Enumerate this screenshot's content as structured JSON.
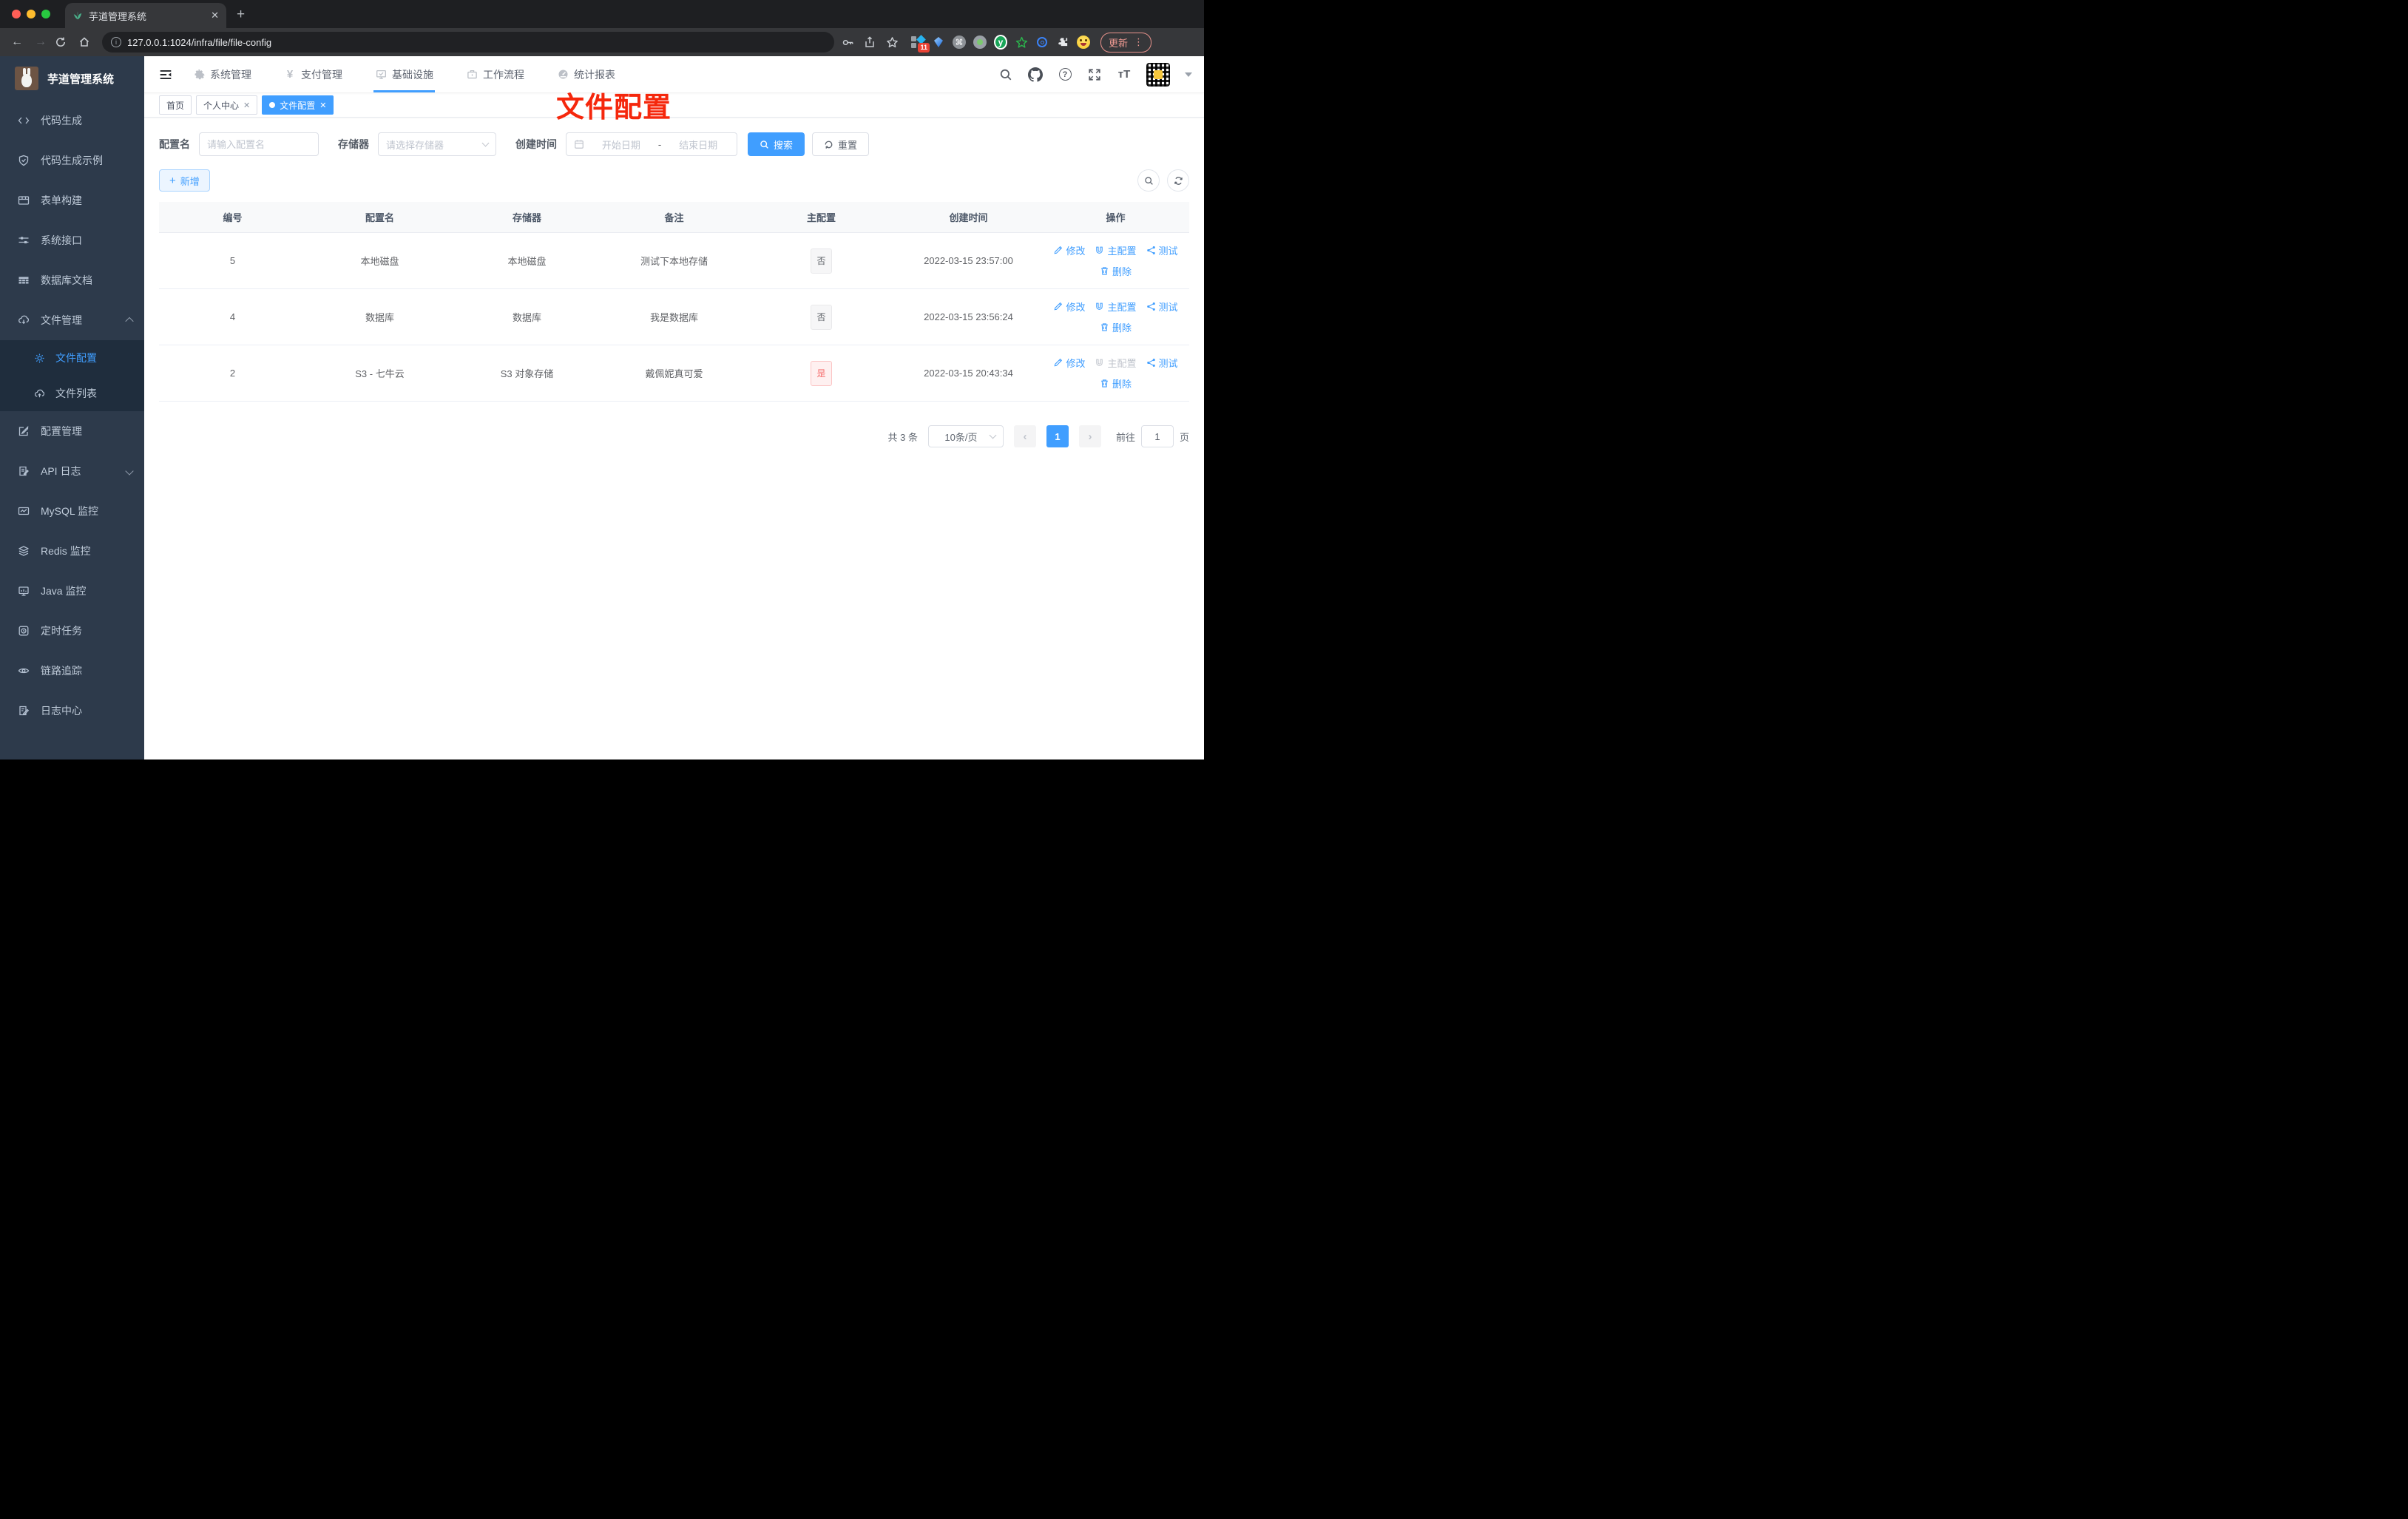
{
  "browser": {
    "tab_title": "芋道管理系统",
    "url": "127.0.0.1:1024/infra/file/file-config",
    "update_label": "更新",
    "extension_badge": "11"
  },
  "annotation_text": "文件配置",
  "sidebar": {
    "title": "芋道管理系统",
    "items": [
      {
        "label": "代码生成"
      },
      {
        "label": "代码生成示例"
      },
      {
        "label": "表单构建"
      },
      {
        "label": "系统接口"
      },
      {
        "label": "数据库文档"
      },
      {
        "label": "文件管理",
        "expanded": true,
        "children": [
          {
            "label": "文件配置",
            "active": true
          },
          {
            "label": "文件列表"
          }
        ]
      },
      {
        "label": "配置管理"
      },
      {
        "label": "API 日志"
      },
      {
        "label": "MySQL 监控"
      },
      {
        "label": "Redis 监控"
      },
      {
        "label": "Java 监控"
      },
      {
        "label": "定时任务"
      },
      {
        "label": "链路追踪"
      },
      {
        "label": "日志中心"
      }
    ]
  },
  "header": {
    "nav": [
      {
        "label": "系统管理"
      },
      {
        "label": "支付管理"
      },
      {
        "label": "基础设施",
        "active": true
      },
      {
        "label": "工作流程"
      },
      {
        "label": "统计报表"
      }
    ],
    "pay_symbol": "¥",
    "font_size_icon": "тT"
  },
  "tags": [
    {
      "label": "首页"
    },
    {
      "label": "个人中心",
      "closable": true
    },
    {
      "label": "文件配置",
      "closable": true,
      "active": true
    }
  ],
  "filters": {
    "name_label": "配置名",
    "name_placeholder": "请输入配置名",
    "storage_label": "存储器",
    "storage_placeholder": "请选择存储器",
    "time_label": "创建时间",
    "start_placeholder": "开始日期",
    "range_separator": "-",
    "end_placeholder": "结束日期",
    "search_label": "搜索",
    "reset_label": "重置"
  },
  "toolbar": {
    "add_label": "新增"
  },
  "table": {
    "headers": [
      "编号",
      "配置名",
      "存储器",
      "备注",
      "主配置",
      "创建时间",
      "操作"
    ],
    "actions": {
      "edit": "修改",
      "master": "主配置",
      "test": "测试",
      "delete": "删除"
    },
    "rows": [
      {
        "id": "5",
        "name": "本地磁盘",
        "storage": "本地磁盘",
        "remark": "测试下本地存储",
        "master": "否",
        "time": "2022-03-15 23:57:00"
      },
      {
        "id": "4",
        "name": "数据库",
        "storage": "数据库",
        "remark": "我是数据库",
        "master": "否",
        "time": "2022-03-15 23:56:24"
      },
      {
        "id": "2",
        "name": "S3 - 七牛云",
        "storage": "S3 对象存储",
        "remark": "戴佩妮真可爱",
        "master": "是",
        "time": "2022-03-15 20:43:34"
      }
    ]
  },
  "pagination": {
    "total": "共 3 条",
    "page_size": "10条/页",
    "current_page": "1",
    "goto_label": "前往",
    "goto_value": "1",
    "page_unit": "页"
  },
  "colors": {
    "accent": "#409eff",
    "danger": "#f56c6c",
    "annotation_red": "#f5270c",
    "sidebar_bg": "#2d3a4b",
    "submenu_bg": "#1f2d3d"
  }
}
